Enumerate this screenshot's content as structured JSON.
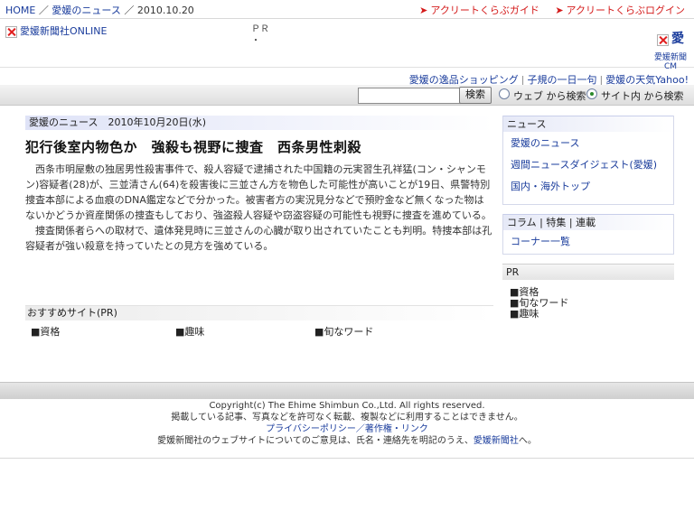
{
  "header": {
    "breadcrumb": {
      "home": "HOME",
      "sep1": " ／ ",
      "section": "愛媛のニュース",
      "sep2": " ／ ",
      "date": "2010.10.20"
    },
    "links": [
      {
        "label": "アクリートくらぶガイド"
      },
      {
        "label": "アクリートくらぶログイン"
      }
    ]
  },
  "ads": {
    "logo_alt": "愛媛新聞社ONLINE",
    "pr_label": "ＰＲ",
    "pr_dot": "・",
    "cm_char": "愛",
    "cm_label": "愛媛新聞CM"
  },
  "sublinks": [
    {
      "label": "愛媛の逸品ショッピング"
    },
    {
      "label": "子規の一日一句"
    },
    {
      "label": "愛媛の天気Yahoo!"
    }
  ],
  "search": {
    "input_value": "",
    "button": "検索",
    "option_web": "ウェブ から検索",
    "option_site": "サイト内 から検索"
  },
  "article": {
    "section_head": "愛媛のニュース　2010年10月20日(水)",
    "headline": "犯行後室内物色か　強殺も視野に捜査　西条男性刺殺",
    "paragraphs": [
      "西条市明屋敷の独居男性殺害事件で、殺人容疑で逮捕された中国籍の元実習生孔祥猛(コン・シャンモン)容疑者(28)が、三並清さん(64)を殺害後に三並さん方を物色した可能性が高いことが19日、県警特別捜査本部による血痕のDNA鑑定などで分かった。被害者方の実況見分などで預貯金など無くなった物はないかどうか資産関係の捜査もしており、強盗殺人容疑や窃盗容疑の可能性も視野に捜査を進めている。",
      "捜査関係者らへの取材で、遺体発見時に三並さんの心臓が取り出されていたことも判明。特捜本部は孔容疑者が強い殺意を持っていたとの見方を強めている。"
    ]
  },
  "recommend": {
    "head": "おすすめサイト(PR)",
    "items": [
      "■資格",
      "■趣味",
      "■旬なワード"
    ]
  },
  "sidebar": {
    "news_head": "ニュース",
    "news_links": [
      "愛媛のニュース",
      "週間ニュースダイジェスト(愛媛)",
      "国内・海外トップ"
    ],
    "column_head": "コラム | 特集 | 連載",
    "column_links": [
      "コーナー一覧"
    ],
    "pr_head": "PR",
    "pr_items": [
      "■資格",
      "■旬なワード",
      "■趣味"
    ]
  },
  "footer": {
    "copyright": "Copyright(c) The Ehime Shimbun Co.,Ltd. All rights reserved.",
    "notice": "掲載している記事、写真などを許可なく転載、複製などに利用することはできません。",
    "privacy": "プライバシーポリシー／著作権・リンク",
    "contact_prefix": "愛媛新聞社のウェブサイトについてのご意見は、氏名・連絡先を明記のうえ、",
    "contact_link": "愛媛新聞社",
    "contact_suffix": "へ。"
  },
  "colors": {
    "link": "#1a3c9c",
    "accent_red": "#d41a1a"
  }
}
